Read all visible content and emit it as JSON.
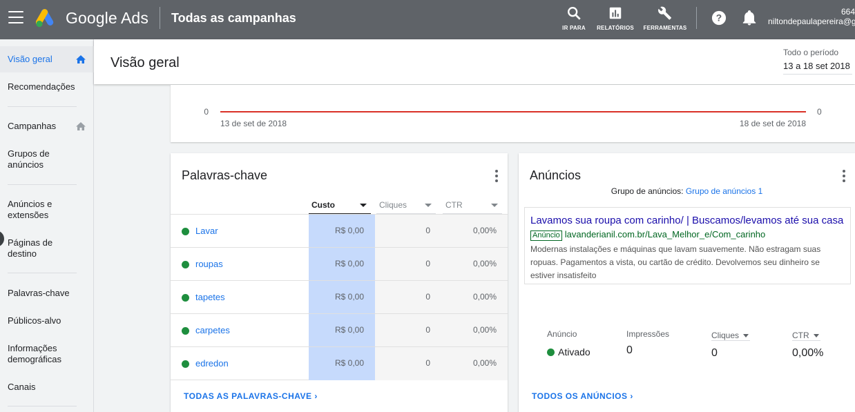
{
  "topbar": {
    "brand": "Google Ads",
    "title": "Todas as campanhas",
    "tools": [
      {
        "label": "IR PARA",
        "icon": "search-icon"
      },
      {
        "label": "RELATÓRIOS",
        "icon": "reports-icon"
      },
      {
        "label": "FERRAMENTAS",
        "icon": "wrench-icon"
      }
    ],
    "account_id": "664-",
    "account_email": "niltondepaulapereira@g"
  },
  "sidebar": {
    "items": [
      {
        "label": "Visão geral",
        "active": true,
        "icon": "home-icon"
      },
      {
        "label": "Recomendações"
      },
      {
        "label": "Campanhas",
        "icon": "home-icon"
      },
      {
        "label": "Grupos de anúncios"
      },
      {
        "label": "Anúncios e extensões"
      },
      {
        "label": "Páginas de destino"
      },
      {
        "label": "Palavras-chave"
      },
      {
        "label": "Públicos-alvo"
      },
      {
        "label": "Informações demográficas"
      },
      {
        "label": "Canais"
      }
    ]
  },
  "header": {
    "title": "Visão geral",
    "period_label": "Todo o período",
    "period_range": "13 a 18 set 2018"
  },
  "chart_data": {
    "type": "line",
    "x": [
      "13 de set de 2018",
      "18 de set de 2018"
    ],
    "series": [
      {
        "values": [
          0,
          0
        ]
      }
    ],
    "left_axis_label": "0",
    "right_axis_label": "0",
    "ylim": [
      0,
      0
    ],
    "line_color": "#d93025"
  },
  "keywords": {
    "title": "Palavras-chave",
    "columns": [
      "Custo",
      "Cliques",
      "CTR"
    ],
    "rows": [
      {
        "keyword": "Lavar",
        "cost": "R$ 0,00",
        "clicks": "0",
        "ctr": "0,00%"
      },
      {
        "keyword": "roupas",
        "cost": "R$ 0,00",
        "clicks": "0",
        "ctr": "0,00%"
      },
      {
        "keyword": "tapetes",
        "cost": "R$ 0,00",
        "clicks": "0",
        "ctr": "0,00%"
      },
      {
        "keyword": "carpetes",
        "cost": "R$ 0,00",
        "clicks": "0",
        "ctr": "0,00%"
      },
      {
        "keyword": "edredon",
        "cost": "R$ 0,00",
        "clicks": "0",
        "ctr": "0,00%"
      }
    ],
    "all_link": "TODAS AS PALAVRAS-CHAVE"
  },
  "ads": {
    "title": "Anúncios",
    "adgroup_label": "Grupo de anúncios:",
    "adgroup_name": "Grupo de anúncios 1",
    "ad": {
      "headline": "Lavamos sua roupa com carinho/ | Buscamos/levamos até sua casa",
      "badge": "Anúncio",
      "url": "lavanderianil.com.br/Lava_Melhor_e/Com_carinho",
      "description": "Modernas instalações e máquinas que lavam suavemente. Não estragam suas ropuas. Pagamentos a vista, ou cartão de crédito. Devolvemos seu dinheiro se estiver insatisfeito"
    },
    "stats": {
      "status_label": "Anúncio",
      "status_value": "Ativado",
      "impressions_label": "Impressões",
      "impressions_value": "0",
      "clicks_label": "Cliques",
      "clicks_value": "0",
      "ctr_label": "CTR",
      "ctr_value": "0,00%"
    },
    "all_link": "TODOS OS ANÚNCIOS"
  },
  "colors": {
    "topbar": "#5f6368",
    "accent": "#1a73e8",
    "status_green": "#1e8e3e",
    "chart_line": "#d93025"
  }
}
